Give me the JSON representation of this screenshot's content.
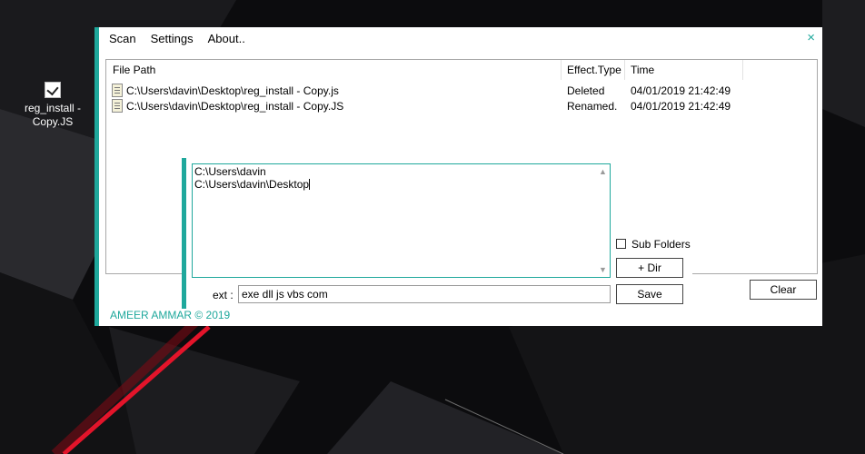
{
  "desktop": {
    "icon": {
      "icon": "js-file-icon",
      "label_line1": "reg_install -",
      "label_line2": "Copy.JS"
    }
  },
  "app": {
    "menu": [
      "Scan",
      "Settings",
      "About.."
    ],
    "close_icon": "×",
    "table": {
      "columns": [
        "File Path",
        "Effect.Type",
        "Time"
      ],
      "rows": [
        {
          "path": "C:\\Users\\davin\\Desktop\\reg_install - Copy.js",
          "effect": "Deleted",
          "time": "04/01/2019 21:42:49"
        },
        {
          "path": "C:\\Users\\davin\\Desktop\\reg_install - Copy.JS",
          "effect": "Renamed.",
          "time": "04/01/2019 21:42:49"
        }
      ]
    },
    "clear_label": "Clear",
    "footer": "AMEER AMMAR © 2019",
    "accent_color": "#1fa89c"
  },
  "settings_panel": {
    "dirs": [
      "C:\\Users\\davin",
      "C:\\Users\\davin\\Desktop"
    ],
    "subfolders_label": "Sub Folders",
    "subfolders_checked": false,
    "add_dir_label": "+ Dir",
    "save_label": "Save",
    "ext_label": "ext :",
    "ext_value": "exe dll js vbs com"
  }
}
